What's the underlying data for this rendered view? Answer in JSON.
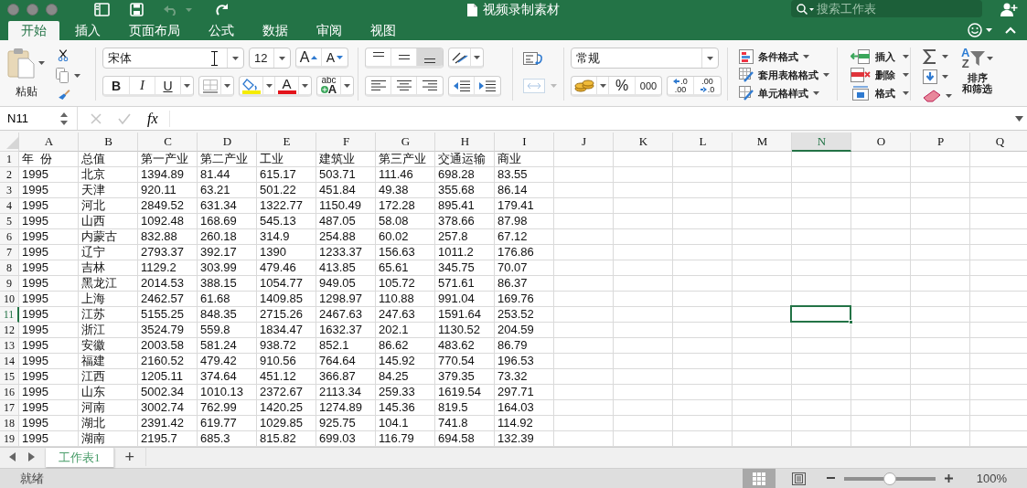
{
  "window": {
    "title": "视频录制素材",
    "undo_disabled": true
  },
  "search": {
    "placeholder": "搜索工作表"
  },
  "ribbon_tabs": [
    {
      "label": "开始",
      "selected": true
    },
    {
      "label": "插入",
      "selected": false
    },
    {
      "label": "页面布局",
      "selected": false
    },
    {
      "label": "公式",
      "selected": false
    },
    {
      "label": "数据",
      "selected": false
    },
    {
      "label": "审阅",
      "selected": false
    },
    {
      "label": "视图",
      "selected": false
    }
  ],
  "ribbon": {
    "paste_label": "粘贴",
    "font": {
      "name": "宋体",
      "size": "12",
      "grow": "A",
      "shrink": "A",
      "bold": "B",
      "italic": "I",
      "underline": "U",
      "font_color": "A",
      "phonetic_top": "abc",
      "phonetic_bottom": "A"
    },
    "vertical_align": [
      {
        "kind": "top",
        "selected": false
      },
      {
        "kind": "middle",
        "selected": false
      },
      {
        "kind": "bottom",
        "selected": true
      }
    ],
    "horizontal_align": [
      {
        "kind": "left",
        "selected": false
      },
      {
        "kind": "center",
        "selected": false
      },
      {
        "kind": "right",
        "selected": false
      }
    ],
    "merge_disabled": true,
    "number": {
      "format": "常规",
      "percent": "%",
      "thousands": "000",
      "decimals": [
        {
          "kind": "increase",
          "top": ".0",
          "bottom": ".00"
        },
        {
          "kind": "decrease",
          "top": ".00",
          "bottom": ".0"
        }
      ]
    },
    "styles": [
      {
        "kind": "conditional",
        "label": "条件格式"
      },
      {
        "kind": "table",
        "label": "套用表格格式"
      },
      {
        "kind": "cell",
        "label": "单元格样式"
      }
    ],
    "cells": [
      {
        "kind": "insert",
        "label": "插入"
      },
      {
        "kind": "delete",
        "label": "删除"
      },
      {
        "kind": "format",
        "label": "格式"
      }
    ],
    "sort": {
      "letters": [
        "A",
        "Z"
      ],
      "label": [
        "排序",
        "和筛选"
      ]
    }
  },
  "formula_bar": {
    "name_box": "N11",
    "function_button": "fx"
  },
  "sheet": {
    "columns": [
      {
        "label": "A",
        "selected": false
      },
      {
        "label": "B",
        "selected": false
      },
      {
        "label": "C",
        "selected": false
      },
      {
        "label": "D",
        "selected": false
      },
      {
        "label": "E",
        "selected": false
      },
      {
        "label": "F",
        "selected": false
      },
      {
        "label": "G",
        "selected": false
      },
      {
        "label": "H",
        "selected": false
      },
      {
        "label": "I",
        "selected": false
      },
      {
        "label": "J",
        "selected": false
      },
      {
        "label": "K",
        "selected": false
      },
      {
        "label": "L",
        "selected": false
      },
      {
        "label": "M",
        "selected": false
      },
      {
        "label": "N",
        "selected": true
      },
      {
        "label": "O",
        "selected": false
      },
      {
        "label": "P",
        "selected": false
      },
      {
        "label": "Q",
        "selected": false
      }
    ],
    "rows": [
      {
        "label": "1",
        "selected": false,
        "cells": [
          "年  份",
          "总值",
          "第一产业",
          "第二产业",
          "工业",
          "建筑业",
          "第三产业",
          "交通运输",
          "商业"
        ]
      },
      {
        "label": "2",
        "selected": false,
        "cells": [
          "1995",
          "北京",
          "1394.89",
          "81.44",
          "615.17",
          "503.71",
          "111.46",
          "698.28",
          "83.55"
        ]
      },
      {
        "label": "3",
        "selected": false,
        "cells": [
          "1995",
          "天津",
          "920.11",
          "63.21",
          "501.22",
          "451.84",
          "49.38",
          "355.68",
          "86.14"
        ]
      },
      {
        "label": "4",
        "selected": false,
        "cells": [
          "1995",
          "河北",
          "2849.52",
          "631.34",
          "1322.77",
          "1150.49",
          "172.28",
          "895.41",
          "179.41"
        ]
      },
      {
        "label": "5",
        "selected": false,
        "cells": [
          "1995",
          "山西",
          "1092.48",
          "168.69",
          "545.13",
          "487.05",
          "58.08",
          "378.66",
          "87.98"
        ]
      },
      {
        "label": "6",
        "selected": false,
        "cells": [
          "1995",
          "内蒙古",
          "832.88",
          "260.18",
          "314.9",
          "254.88",
          "60.02",
          "257.8",
          "67.12"
        ]
      },
      {
        "label": "7",
        "selected": false,
        "cells": [
          "1995",
          "辽宁",
          "2793.37",
          "392.17",
          "1390",
          "1233.37",
          "156.63",
          "1011.2",
          "176.86"
        ]
      },
      {
        "label": "8",
        "selected": false,
        "cells": [
          "1995",
          "吉林",
          "1129.2",
          "303.99",
          "479.46",
          "413.85",
          "65.61",
          "345.75",
          "70.07"
        ]
      },
      {
        "label": "9",
        "selected": false,
        "cells": [
          "1995",
          "黑龙江",
          "2014.53",
          "388.15",
          "1054.77",
          "949.05",
          "105.72",
          "571.61",
          "86.37"
        ]
      },
      {
        "label": "10",
        "selected": false,
        "cells": [
          "1995",
          "上海",
          "2462.57",
          "61.68",
          "1409.85",
          "1298.97",
          "110.88",
          "991.04",
          "169.76"
        ]
      },
      {
        "label": "11",
        "selected": true,
        "cells": [
          "1995",
          "江苏",
          "5155.25",
          "848.35",
          "2715.26",
          "2467.63",
          "247.63",
          "1591.64",
          "253.52"
        ]
      },
      {
        "label": "12",
        "selected": false,
        "cells": [
          "1995",
          "浙江",
          "3524.79",
          "559.8",
          "1834.47",
          "1632.37",
          "202.1",
          "1130.52",
          "204.59"
        ]
      },
      {
        "label": "13",
        "selected": false,
        "cells": [
          "1995",
          "安徽",
          "2003.58",
          "581.24",
          "938.72",
          "852.1",
          "86.62",
          "483.62",
          "86.79"
        ]
      },
      {
        "label": "14",
        "selected": false,
        "cells": [
          "1995",
          "福建",
          "2160.52",
          "479.42",
          "910.56",
          "764.64",
          "145.92",
          "770.54",
          "196.53"
        ]
      },
      {
        "label": "15",
        "selected": false,
        "cells": [
          "1995",
          "江西",
          "1205.11",
          "374.64",
          "451.12",
          "366.87",
          "84.25",
          "379.35",
          "73.32"
        ]
      },
      {
        "label": "16",
        "selected": false,
        "cells": [
          "1995",
          "山东",
          "5002.34",
          "1010.13",
          "2372.67",
          "2113.34",
          "259.33",
          "1619.54",
          "297.71"
        ]
      },
      {
        "label": "17",
        "selected": false,
        "cells": [
          "1995",
          "河南",
          "3002.74",
          "762.99",
          "1420.25",
          "1274.89",
          "145.36",
          "819.5",
          "164.03"
        ]
      },
      {
        "label": "18",
        "selected": false,
        "cells": [
          "1995",
          "湖北",
          "2391.42",
          "619.77",
          "1029.85",
          "925.75",
          "104.1",
          "741.8",
          "114.92"
        ]
      },
      {
        "label": "19",
        "selected": false,
        "cells": [
          "1995",
          "湖南",
          "2195.7",
          "685.3",
          "815.82",
          "699.03",
          "116.79",
          "694.58",
          "132.39"
        ]
      }
    ]
  },
  "sheet_tabs": [
    {
      "label": "工作表1",
      "selected": true
    }
  ],
  "add_sheet": "+",
  "status_bar": {
    "status": "就绪",
    "views": [
      {
        "kind": "normal",
        "selected": true
      },
      {
        "kind": "page_layout",
        "selected": false
      }
    ],
    "zoom": {
      "level": 0.5,
      "value": "100%"
    }
  }
}
